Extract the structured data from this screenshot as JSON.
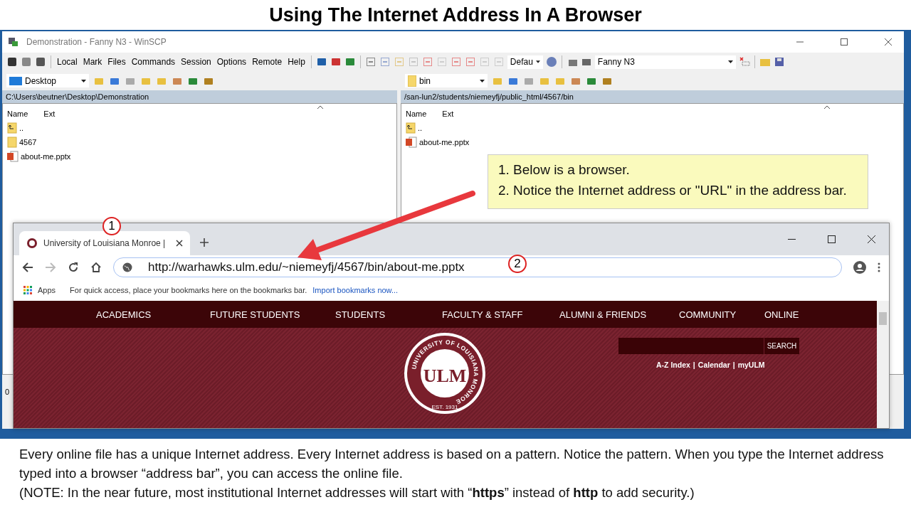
{
  "slide": {
    "title": "Using The Internet Address In A Browser"
  },
  "winscp": {
    "title": "Demonstration - Fanny N3 - WinSCP",
    "menu": [
      "Local",
      "Mark",
      "Files",
      "Commands",
      "Session",
      "Options",
      "Remote",
      "Help"
    ],
    "transfer_preset": "Defau",
    "session": "Fanny N3",
    "panels": [
      {
        "location": {
          "name": "Desktop",
          "kind": "desktop"
        },
        "path": "C:\\Users\\beutner\\Desktop\\Demonstration",
        "columns": [
          "Name",
          "Ext"
        ],
        "files": [
          {
            "name": "..",
            "kind": "parent"
          },
          {
            "name": "4567",
            "kind": "folder"
          },
          {
            "name": "about-me.pptx",
            "kind": "pptx"
          }
        ]
      },
      {
        "location": {
          "name": "bin",
          "kind": "folder"
        },
        "path": "/san-lun2/students/niemeyfj/public_html/4567/bin",
        "columns": [
          "Name",
          "Ext"
        ],
        "files": [
          {
            "name": "..",
            "kind": "parent"
          },
          {
            "name": "about-me.pptx",
            "kind": "pptx"
          }
        ]
      }
    ],
    "status_text": "0"
  },
  "callout": {
    "lines": [
      "1. Below is a browser.",
      "2. Notice the Internet address or \"URL\" in the address bar."
    ]
  },
  "markers": [
    "1",
    "2"
  ],
  "browser": {
    "tabs": [
      {
        "title": "University of Louisiana Monroe |",
        "selected": true
      }
    ],
    "url": "http://warhawks.ulm.edu/~niemeyfj/4567/bin/about-me.pptx",
    "bookmarks": {
      "apps": "Apps",
      "hint": "For quick access, place your bookmarks here on the bookmarks bar.",
      "import_link": "Import bookmarks now..."
    },
    "site": {
      "nav": [
        "ACADEMICS",
        "FUTURE STUDENTS",
        "STUDENTS",
        "FACULTY & STAFF",
        "ALUMNI & FRIENDS",
        "COMMUNITY",
        "ONLINE"
      ],
      "search_button": "SEARCH",
      "links": [
        "A-Z Index",
        "Calendar",
        "myULM"
      ],
      "link_separator": "|",
      "seal": {
        "ring": "UNIVERSITY OF LOUISIANA MONROE",
        "monogram": "ULM",
        "est": "EST. 1931"
      }
    }
  },
  "caption": [
    "Every online file has a unique Internet address. Every Internet address is based on a pattern. Notice the pattern. When you type the Internet address typed into a browser “address bar”, you can access the online file.",
    "(NOTE: In the near future, most institutional Internet addresses will start with “**https**” instead of **http** to add security.)"
  ]
}
